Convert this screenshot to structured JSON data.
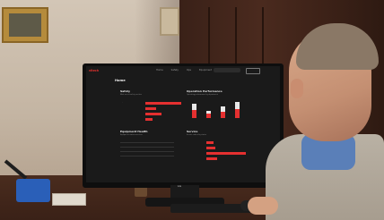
{
  "scene": {
    "description_hidden": "",
    "monitor_brand": "LG"
  },
  "screen_ui": {
    "brand": "vitech",
    "nav_items": [
      "Home",
      "Safety",
      "Ops",
      "Equipment",
      "Service"
    ],
    "page_title": "Home",
    "sections": {
      "safety": {
        "title": "Safety",
        "subtitle": "Most recent safety metrics"
      },
      "operation": {
        "title": "Operation Performance",
        "subtitle": "Operating performance by department"
      },
      "equipment": {
        "title": "Equipment Health",
        "subtitle": "Equipment status overview"
      },
      "service": {
        "title": "Service",
        "subtitle": "Service orders by status"
      }
    }
  }
}
